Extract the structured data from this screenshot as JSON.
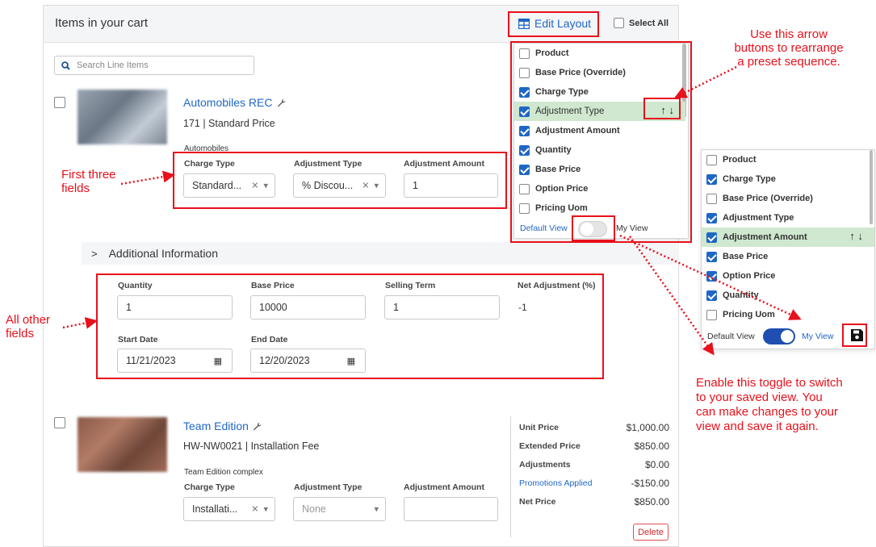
{
  "cart": {
    "title": "Items in your cart",
    "edit_layout_label": "Edit Layout",
    "select_all_label": "Select All",
    "search_placeholder": "Search Line Items"
  },
  "item1": {
    "name": "Automobiles REC",
    "code": "171",
    "price_type": "Standard Price",
    "subline": "171 | Standard Price",
    "family": "Automobiles",
    "fields": [
      {
        "label": "Charge Type",
        "value": "Standard..."
      },
      {
        "label": "Adjustment Type",
        "value": "% Discou..."
      },
      {
        "label": "Adjustment Amount",
        "value": "1"
      }
    ],
    "additional_info_label": "Additional Information",
    "other_fields": {
      "quantity_label": "Quantity",
      "quantity": "1",
      "base_price_label": "Base Price",
      "base_price": "10000",
      "selling_term_label": "Selling Term",
      "selling_term": "1",
      "net_adjustment_label": "Net Adjustment (%)",
      "net_adjustment": "-1",
      "start_date_label": "Start Date",
      "start_date": "11/21/2023",
      "end_date_label": "End Date",
      "end_date": "12/20/2023"
    }
  },
  "item2": {
    "name": "Team Edition",
    "subline": "HW-NW0021 | Installation Fee",
    "family": "Team Edition complex",
    "fields": [
      {
        "label": "Charge Type",
        "value": "Installati..."
      },
      {
        "label": "Adjustment Type",
        "value": "None"
      },
      {
        "label": "Adjustment Amount",
        "value": ""
      }
    ],
    "summary": [
      {
        "label": "Unit Price",
        "value": "$1,000.00",
        "link": false
      },
      {
        "label": "Extended Price",
        "value": "$850.00",
        "link": false
      },
      {
        "label": "Adjustments",
        "value": "$0.00",
        "link": false
      },
      {
        "label": "Promotions Applied",
        "value": "-$150.00",
        "link": true
      },
      {
        "label": "Net Price",
        "value": "$850.00",
        "link": false
      }
    ],
    "delete_label": "Delete"
  },
  "layout_dropdown": {
    "items": [
      {
        "label": "Product",
        "checked": false
      },
      {
        "label": "Base Price (Override)",
        "checked": false
      },
      {
        "label": "Charge Type",
        "checked": true
      },
      {
        "label": "Adjustment Type",
        "checked": true,
        "highlighted": true
      },
      {
        "label": "Adjustment Amount",
        "checked": true
      },
      {
        "label": "Quantity",
        "checked": true
      },
      {
        "label": "Base Price",
        "checked": true
      },
      {
        "label": "Option Price",
        "checked": false
      },
      {
        "label": "Pricing Uom",
        "checked": false
      }
    ],
    "default_view_label": "Default View",
    "my_view_label": "My View",
    "toggle_on": false
  },
  "layout_dropdown_saved": {
    "items": [
      {
        "label": "Product",
        "checked": false
      },
      {
        "label": "Charge Type",
        "checked": true
      },
      {
        "label": "Base Price (Override)",
        "checked": false
      },
      {
        "label": "Adjustment Type",
        "checked": true
      },
      {
        "label": "Adjustment Amount",
        "checked": true,
        "highlighted": true
      },
      {
        "label": "Base Price",
        "checked": true
      },
      {
        "label": "Option Price",
        "checked": true
      },
      {
        "label": "Quantity",
        "checked": true
      },
      {
        "label": "Pricing Uom",
        "checked": false
      }
    ],
    "default_view_label": "Default View",
    "my_view_label": "My View",
    "toggle_on": true
  },
  "annotations": {
    "first_three": [
      "First three",
      "fields"
    ],
    "all_other": [
      "All other",
      "fields"
    ],
    "arrows_note": [
      "Use this arrow",
      "buttons to rearrange",
      "a preset sequence."
    ],
    "toggle_note": [
      "Enable this toggle to switch",
      "to your saved view. You",
      "can make changes to your",
      "view and save it again."
    ]
  },
  "colors": {
    "accent": "#1f67c5",
    "annotation": "#e8101b",
    "highlight": "#cfe8cf"
  }
}
